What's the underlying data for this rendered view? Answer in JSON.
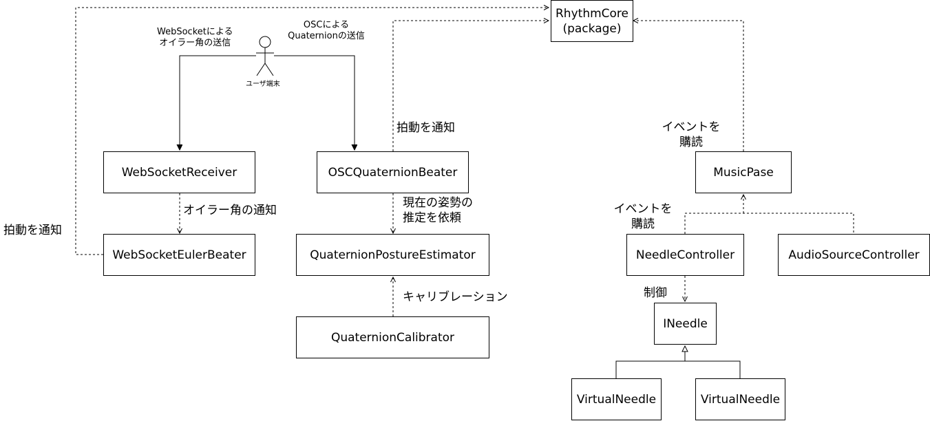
{
  "nodes": {
    "rhythm_core": "RhythmCore\n(package)",
    "websocket_receiver": "WebSocketReceiver",
    "websocket_euler_beater": "WebSocketEulerBeater",
    "osc_quaternion_beater": "OSCQuaternionBeater",
    "quaternion_posture_estimator": "QuaternionPostureEstimator",
    "quaternion_calibrator": "QuaternionCalibrator",
    "music_pase": "MusicPase",
    "needle_controller": "NeedleController",
    "audio_source_controller": "AudioSourceController",
    "ineedle": "INeedle",
    "virtual_needle_1": "VirtualNeedle",
    "virtual_needle_2": "VirtualNeedle"
  },
  "actor": {
    "label": "ユーザ端末"
  },
  "edge_labels": {
    "websocket_send": "WebSocketによる\nオイラー角の送信",
    "osc_send": "OSCによる\nQuaternionの送信",
    "beat_notify_osc": "拍動を通知",
    "beat_notify_left": "拍動を通知",
    "euler_notify": "オイラー角の通知",
    "posture_request": "現在の姿勢の\n推定を依頼",
    "calibration": "キャリブレーション",
    "subscribe_event_music": "イベントを\n購読",
    "subscribe_event_needle": "イベントを\n購読",
    "control": "制御"
  }
}
